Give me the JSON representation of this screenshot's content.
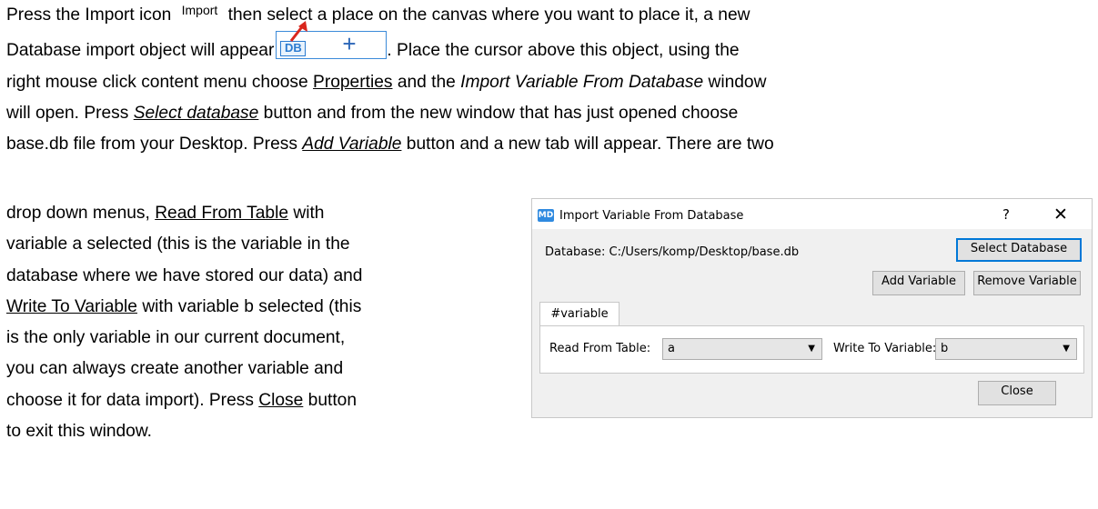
{
  "paragraph": {
    "t1": "Press the Import icon ",
    "import_icon_label": "Import",
    "t2": " then select a place on the canvas where you want to place it, a new",
    "t3": "Database import object will appear",
    "db_icon_text": "DB",
    "db_plus": "+",
    "t4": ". Place the cursor above this object, using the",
    "t5": "right mouse click content menu choose ",
    "properties": "Properties",
    "t6": " and the ",
    "window_name": "Import Variable From Database",
    "t7": " window",
    "t8": "will open. Press ",
    "select_database": "Select database",
    "t9": " button and from the new window that has just opened choose",
    "t10": "base.db file from your Desktop. Press ",
    "add_variable": "Add Variable",
    "t11": " button and a new tab will appear. There are two"
  },
  "left_column": {
    "l1": "drop down menus, ",
    "read_from_table": "Read From Table",
    "l1b": " with",
    "l2": "variable a selected (this is the variable in the",
    "l3": "database where we have stored our data) and",
    "write_to_variable": "Write To Variable",
    "l4b": " with variable b selected (this",
    "l5": "is the only variable in our current document,",
    "l6": "you can always create another variable and",
    "l7": "choose it for data import). Press ",
    "close": "Close",
    "l7b": " button",
    "l8": "to exit this window."
  },
  "dialog": {
    "app_icon": "MD",
    "title": "Import Variable From Database",
    "help": "?",
    "close_glyph": "✕",
    "database_label": "Database:  C:/Users/komp/Desktop/base.db",
    "select_database_button": "Select Database",
    "add_variable_button": "Add Variable",
    "remove_variable_button": "Remove Variable",
    "tab_label": "#variable",
    "read_from_table_label": "Read From Table:",
    "read_from_table_value": "a",
    "write_to_variable_label": "Write To Variable:",
    "write_to_variable_value": "b",
    "dropdown_arrow": "▼",
    "close_button": "Close"
  },
  "colors": {
    "accent": "#0078d7",
    "db_blue": "#2b7bd0",
    "arrow_red": "#d9261c"
  }
}
